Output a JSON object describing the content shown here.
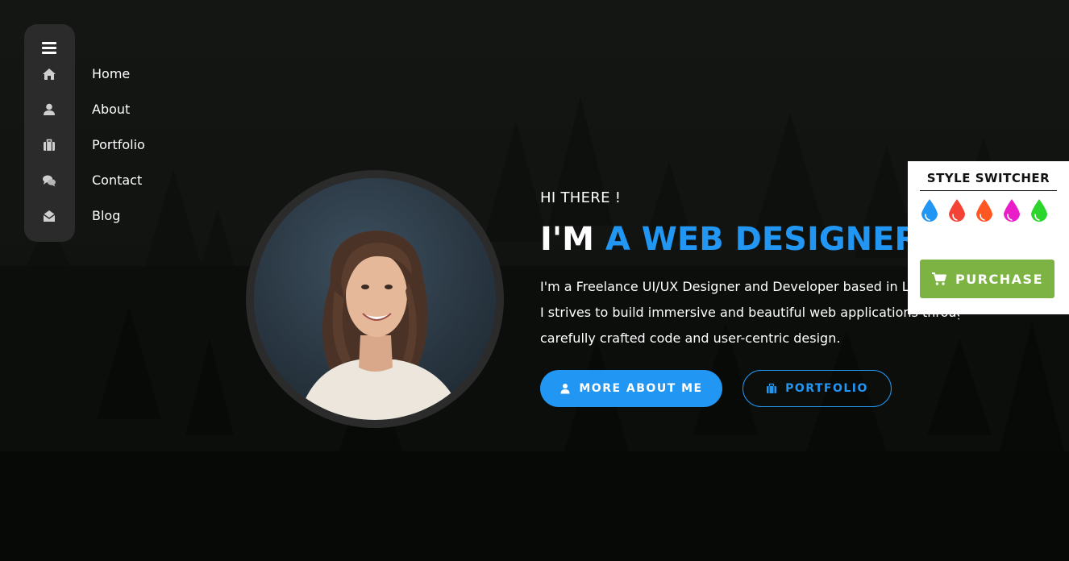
{
  "colors": {
    "accent": "#2196f3",
    "sidebar_bg": "#2a2b2a",
    "purchase": "#7cb342"
  },
  "sidebar": {
    "toggle_icon": "hamburger-menu-icon",
    "items": [
      {
        "label": "Home",
        "icon": "home-icon"
      },
      {
        "label": "About",
        "icon": "user-icon"
      },
      {
        "label": "Portfolio",
        "icon": "briefcase-icon"
      },
      {
        "label": "Contact",
        "icon": "chat-bubbles-icon"
      },
      {
        "label": "Blog",
        "icon": "envelope-open-icon"
      }
    ]
  },
  "hero": {
    "greeting": "HI THERE !",
    "headline_pre": "I'M",
    "headline_accent": "A WEB DESIGNER",
    "bio": [
      "I'm a Freelance UI/UX Designer and Developer based in London, England.",
      "I strives to build immersive and beautiful web applications through",
      "carefully crafted code and user-centric design."
    ],
    "buttons": {
      "primary": {
        "label": "MORE ABOUT ME",
        "icon": "user-icon"
      },
      "secondary": {
        "label": "PORTFOLIO",
        "icon": "briefcase-icon"
      }
    }
  },
  "style_switcher": {
    "title": "STYLE SWITCHER",
    "swatches": [
      "#2196f3",
      "#f44336",
      "#ff5722",
      "#e91ec9",
      "#2cd52c"
    ],
    "purchase_label": "PURCHASE",
    "purchase_icon": "shopping-cart-icon"
  }
}
